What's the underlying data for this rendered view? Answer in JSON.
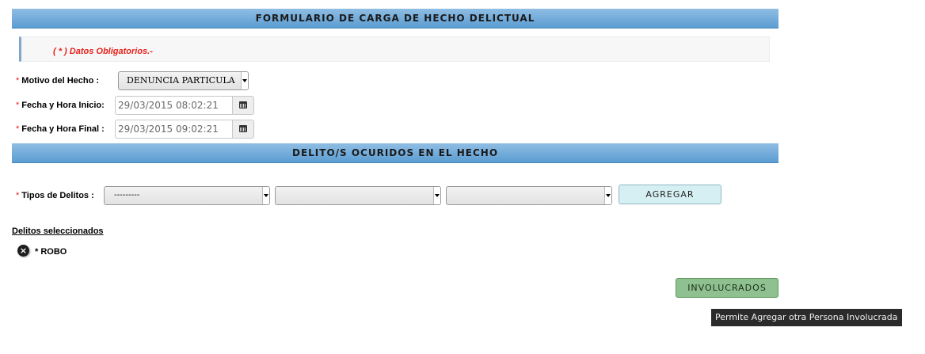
{
  "form": {
    "title": "FORMULARIO DE CARGA DE HECHO DELICTUAL",
    "required_note": "( * ) Datos Obligatorios.-",
    "motivo": {
      "required": "*",
      "label": "Motivo del Hecho :",
      "value": "DENUNCIA PARTICULA"
    },
    "fecha_inicio": {
      "required": "*",
      "label": "Fecha y Hora Inicio:",
      "value": "29/03/2015 08:02:21"
    },
    "fecha_final": {
      "required": "*",
      "label": "Fecha y Hora Final :",
      "value": "29/03/2015 09:02:21"
    }
  },
  "delitos": {
    "title": "DELITO/S OCURIDOS EN EL HECHO",
    "tipos": {
      "required": "*",
      "label": "Tipos de Delitos :",
      "select1": "---------",
      "select2": "",
      "select3": ""
    },
    "agregar_label": "AGREGAR",
    "selected_title": "Delitos seleccionados",
    "selected_items": [
      {
        "label": "* ROBO",
        "remove_icon": "x-circle-icon"
      }
    ]
  },
  "actions": {
    "involucrados_label": "INVOLUCRADOS"
  },
  "tooltip": {
    "text": "Permite Agregar otra Persona Involucrada"
  },
  "colors": {
    "header_blue": "#5b9dd2",
    "required_red": "#e8201a",
    "agregar_bg": "#d6eff2",
    "involucrados_bg": "#8fc08f"
  }
}
